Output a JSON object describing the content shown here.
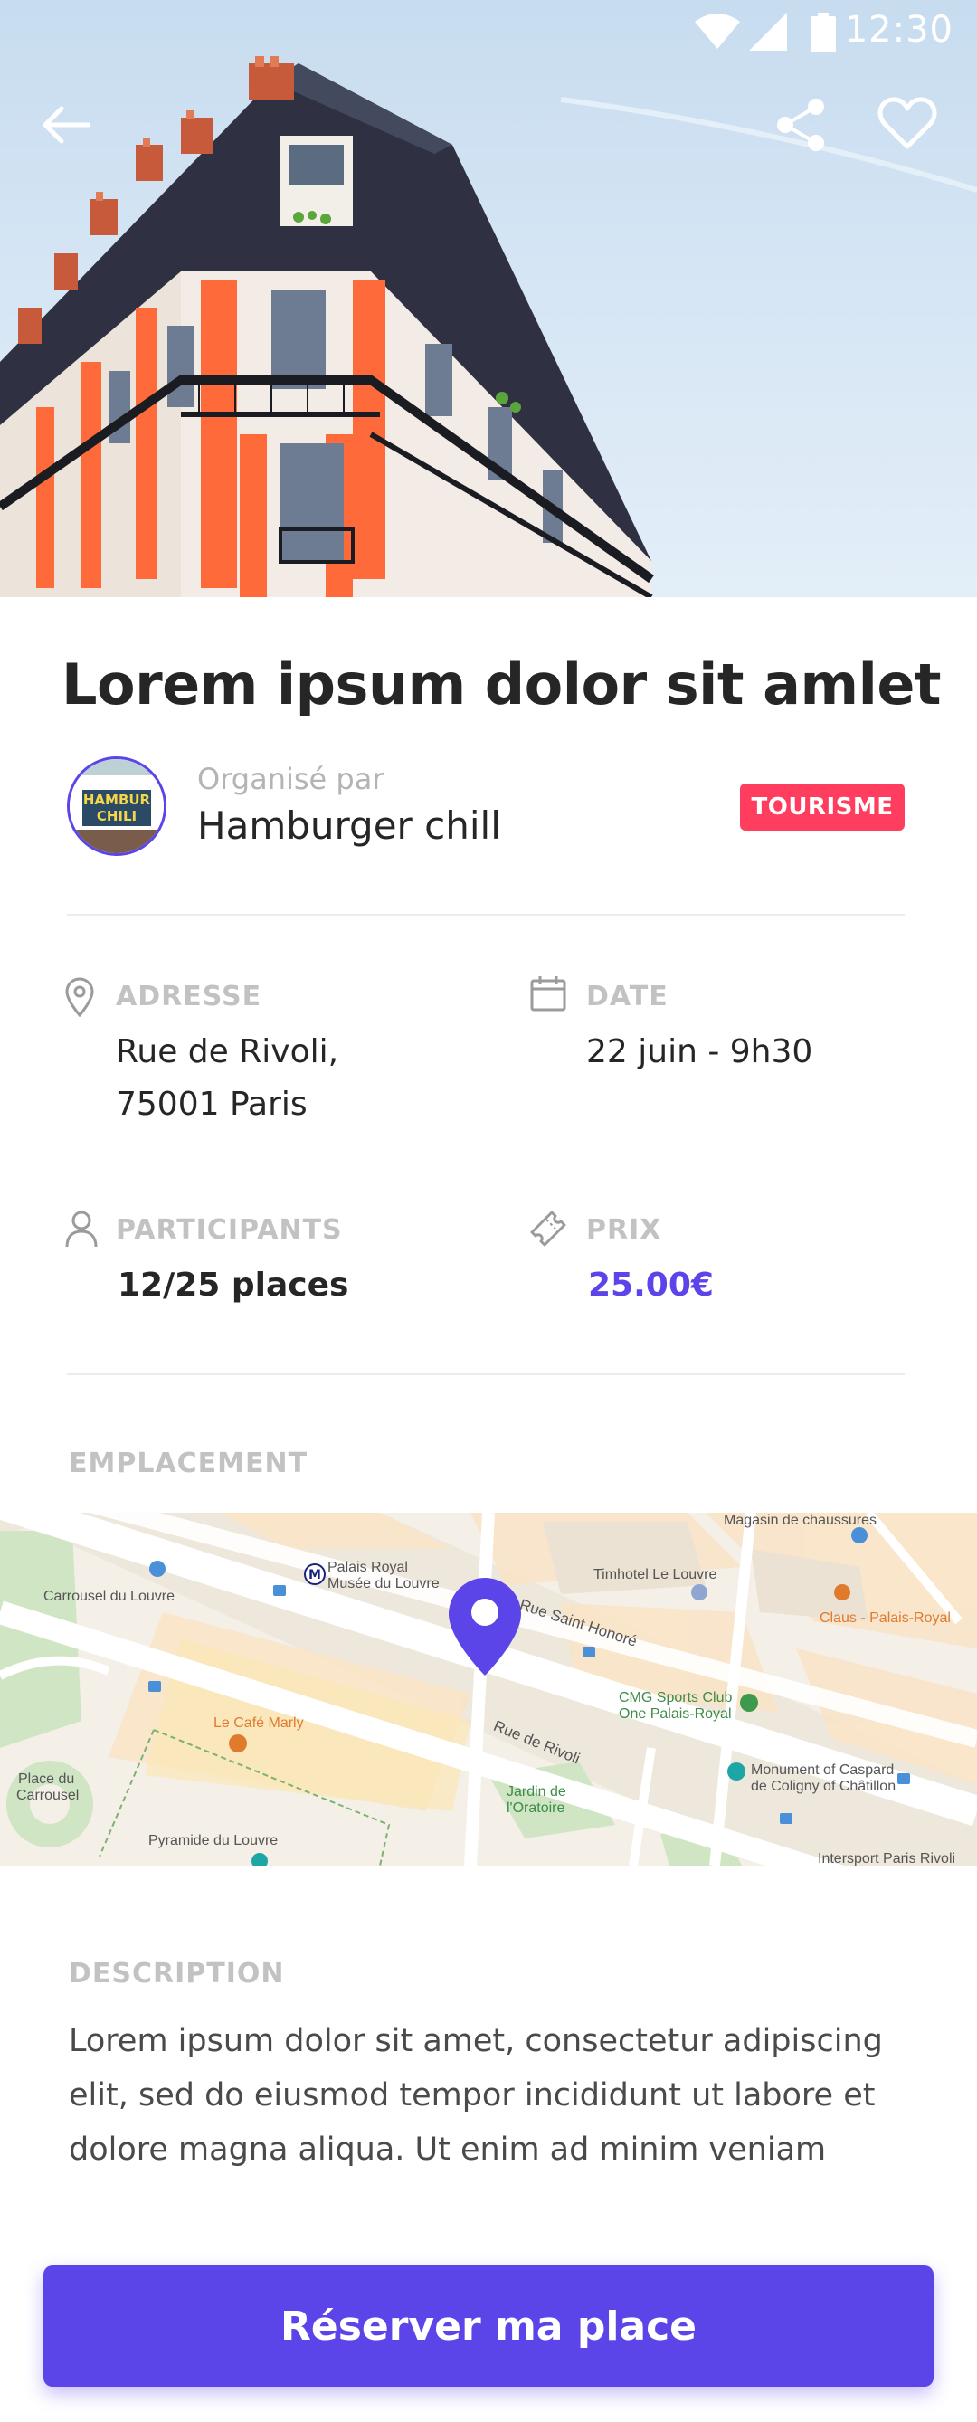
{
  "status_bar": {
    "time": "12:30"
  },
  "event": {
    "title": "Lorem ipsum dolor sit amlet",
    "organizer_label": "Organisé par",
    "organizer_name": "Hamburger chill",
    "avatar_text_line1": "HAMBUR",
    "avatar_text_line2": "CHILI",
    "tag": "TOURISME"
  },
  "info": {
    "address_label": "ADRESSE",
    "address_line1": "Rue de Rivoli,",
    "address_line2": "75001 Paris",
    "date_label": "DATE",
    "date_value": "22 juin - 9h30",
    "participants_label": "PARTICIPANTS",
    "participants_value": "12/25 places",
    "price_label": "PRIX",
    "price_value": "25.00€"
  },
  "map": {
    "section_label": "EMPLACEMENT",
    "labels": {
      "magasin": "Magasin de chaussures",
      "palais_royal_1": "Palais Royal",
      "palais_royal_2": "Musée du Louvre",
      "timhotel": "Timhotel Le Louvre",
      "carrousel": "Carrousel du Louvre",
      "claus": "Claus - Palais-Royal",
      "rue_st_honore": "Rue Saint Honoré",
      "cmg_1": "CMG Sports Club",
      "cmg_2": "One Palais-Royal",
      "cafe_marly": "Le Café Marly",
      "rue_rivoli": "Rue de Rivoli",
      "place_1": "Place du",
      "place_2": "Carrousel",
      "jardin_1": "Jardin de",
      "jardin_2": "l'Oratoire",
      "monument_1": "Monument of Caspard",
      "monument_2": "de Coligny of Châtillon",
      "pyramide": "Pyramide du Louvre",
      "intersport": "Intersport Paris Rivoli",
      "metro_m": "M"
    },
    "colors": {
      "pin": "#5b45e8"
    }
  },
  "description": {
    "label": "DESCRIPTION",
    "text": "Lorem ipsum dolor sit amet, consectetur adipiscing elit, sed do eiusmod tempor incididunt ut labore et dolore magna aliqua. Ut enim ad minim veniam"
  },
  "cta": {
    "label": "Réserver ma place"
  },
  "theme": {
    "accent": "#5b45e8",
    "tag_color": "#ff3d5e"
  }
}
